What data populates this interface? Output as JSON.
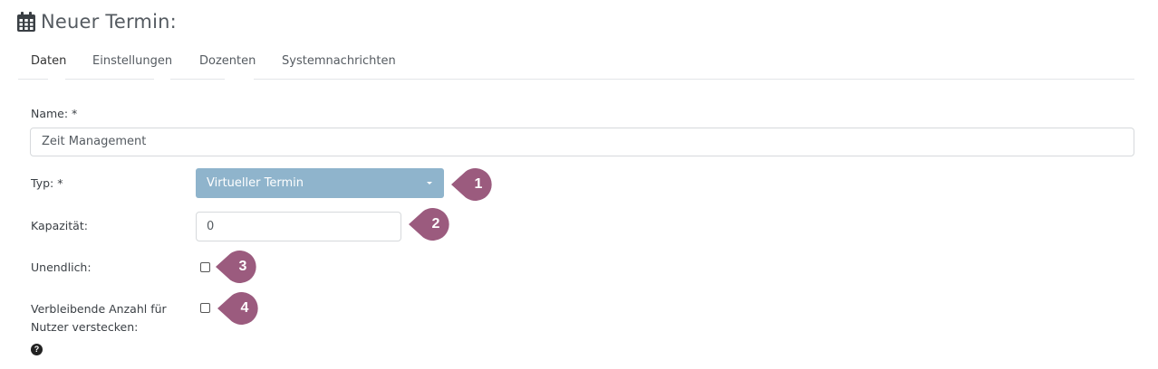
{
  "header": {
    "title": "Neuer Termin:",
    "icon": "calendar-icon"
  },
  "tabs": [
    {
      "label": "Daten",
      "active": true
    },
    {
      "label": "Einstellungen",
      "active": false
    },
    {
      "label": "Dozenten",
      "active": false
    },
    {
      "label": "Systemnachrichten",
      "active": false
    }
  ],
  "form": {
    "name_label": "Name: *",
    "name_value": "Zeit Management",
    "type_label": "Typ: *",
    "type_value": "Virtueller Termin",
    "capacity_label": "Kapazität:",
    "capacity_value": "0",
    "unlimited_label": "Unendlich:",
    "hide_remaining_label_line1": "Verbleibende Anzahl für",
    "hide_remaining_label_line2": "Nutzer verstecken:",
    "help_glyph": "?"
  },
  "markers": [
    "1",
    "2",
    "3",
    "4"
  ],
  "colors": {
    "accent_select": "#8fb4cc",
    "marker": "#9b5b7e"
  }
}
